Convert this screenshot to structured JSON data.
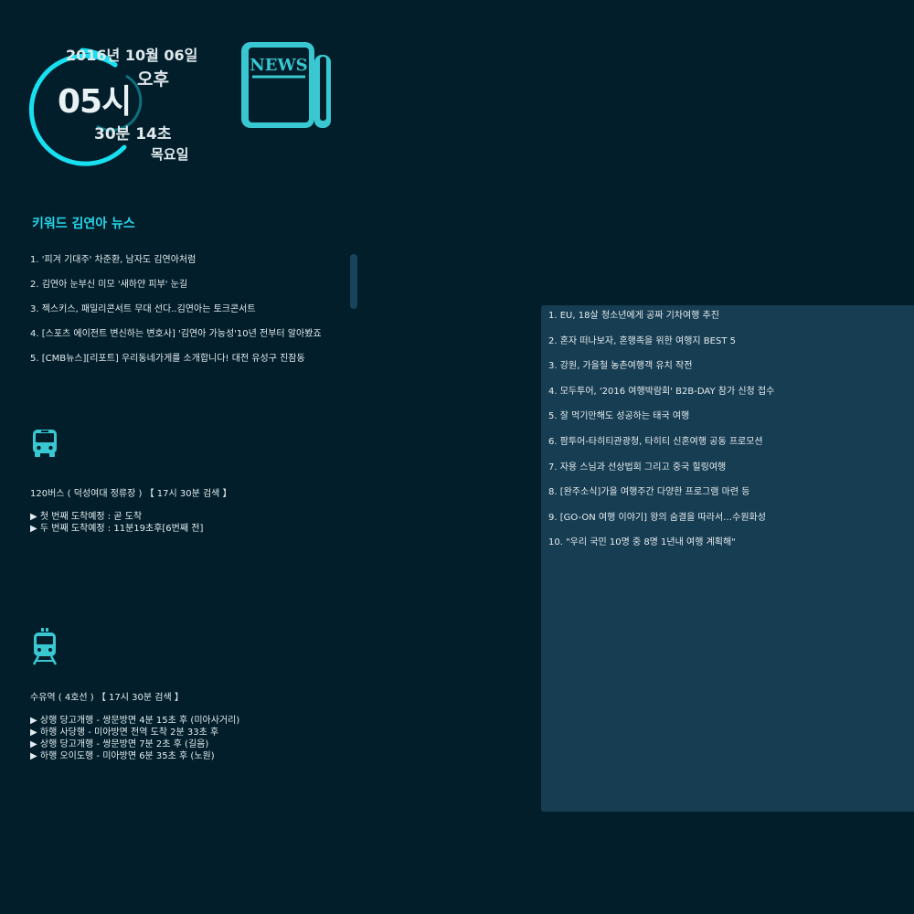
{
  "clock": {
    "date": "2016년 10월 06일",
    "ampm": "오후",
    "hour": "05시",
    "minsec": "30분 14초",
    "weekday": "목요일",
    "accent_color": "#18e0f0"
  },
  "news_icon": {
    "name": "newspaper-icon",
    "text": "NEWS"
  },
  "keyword_news": {
    "title": "키워드  김연아 뉴스",
    "items": [
      "1. '피겨 기대주' 차준환, 남자도 김연아처럼",
      "2. 김연아 눈부신 미모 '새하얀 피부' 눈길",
      "3. 젝스키스, 패밀리콘서트 무대 선다..김연아는 토크콘서트",
      "4. [스포츠 에이전트 변신하는 변호사] '김연아 가능성'10년 전부터 알아봤죠",
      "5. [CMB뉴스][리포트] 우리동네가게를 소개합니다! 대전 유성구 진잠동"
    ]
  },
  "bus": {
    "icon": "bus-icon",
    "title": "120버스 ( 덕성여대 정류장 ) 【 17시 30분 검색 】",
    "lines": [
      "▶ 첫 번째 도착예정  : 곧 도착",
      "▶ 두 번째 도착예정  : 11분19초후[6번째 전]"
    ]
  },
  "subway": {
    "icon": "subway-icon",
    "title": "수유역 ( 4호선 ) 【 17시 30분 검색 】",
    "lines": [
      "▶ 상행 당고개행 - 쌍문방면 4분 15초 후 (미아사거리)",
      "▶ 하행 사당행 - 미아방면 전역 도착 2분 33초 후",
      "▶ 상행 당고개행 - 쌍문방면 7분 2초 후 (길음)",
      "▶ 하행 오이도행 - 미아방면 6분 35초 후 (노원)"
    ]
  },
  "travel_news": {
    "items": [
      "1. EU, 18살 청소년에게 공짜 기차여행 추진",
      "2. 혼자 떠나보자, 혼행족을 위한 여행지 BEST 5",
      "3. 강원, 가을철 농촌여행객 유치 작전",
      "4. 모두투어, '2016 여행박람회' B2B-DAY 참가 신청 접수",
      "5. 잘 먹기만해도 성공하는 태국 여행",
      "6. 팜투어-타히티관광청, 타히티 신혼여행 공동 프로모션",
      "7. 자용 스님과 선상법회 그리고 중국 힐링여행",
      "8. [완주소식]가을 여행주간 다양한 프로그램 마련 등",
      "9. [GO-ON 여행 이야기] 왕의 숨결을 따라서…수원화성",
      "10. \"우리 국민 10명 중 8명 1년내 여행 계획해\""
    ]
  }
}
